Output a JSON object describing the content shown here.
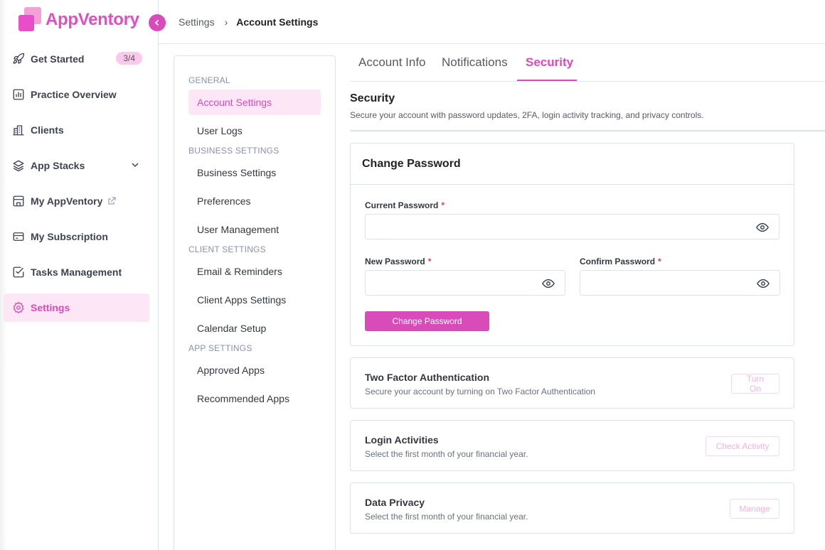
{
  "brand": {
    "name": "AppVentory",
    "accent": "#d94bb9"
  },
  "nav": {
    "items": [
      {
        "key": "get-started",
        "label": "Get Started",
        "icon": "rocket-icon",
        "badge": "3/4"
      },
      {
        "key": "practice-overview",
        "label": "Practice Overview",
        "icon": "bar-chart-icon"
      },
      {
        "key": "clients",
        "label": "Clients",
        "icon": "buildings-icon"
      },
      {
        "key": "app-stacks",
        "label": "App Stacks",
        "icon": "layers-icon"
      },
      {
        "key": "my-appventory",
        "label": "My AppVentory",
        "icon": "storefront-icon"
      },
      {
        "key": "my-subscription",
        "label": "My Subscription",
        "icon": "credit-card-icon"
      },
      {
        "key": "tasks-management",
        "label": "Tasks Management",
        "icon": "checklist-icon"
      },
      {
        "key": "settings",
        "label": "Settings",
        "icon": "gear-icon",
        "active": true
      }
    ]
  },
  "breadcrumb": {
    "root": "Settings",
    "current": "Account Settings"
  },
  "subnav": {
    "general": {
      "heading": "GENERAL",
      "items": [
        "Account Settings",
        "User Logs"
      ]
    },
    "business": {
      "heading": "BUSINESS SETTINGS",
      "items": [
        "Business Settings",
        "Preferences",
        "User Management"
      ]
    },
    "client": {
      "heading": "CLIENT SETTINGS",
      "items": [
        "Email & Reminders",
        "Client Apps Settings",
        "Calendar Setup"
      ]
    },
    "app": {
      "heading": "APP SETTINGS",
      "items": [
        "Approved Apps",
        "Recommended Apps"
      ]
    },
    "active": "Account Settings"
  },
  "tabs": [
    {
      "label": "Account Info"
    },
    {
      "label": "Notifications"
    },
    {
      "label": "Security",
      "active": true
    }
  ],
  "security": {
    "title": "Security",
    "description": "Secure your account with password updates, 2FA, login activity tracking, and privacy controls."
  },
  "change_password": {
    "title": "Change Password",
    "current_label": "Current Password",
    "new_label": "New Password",
    "confirm_label": "Confirm Password",
    "required_mark": "*",
    "current_value": "",
    "new_value": "",
    "confirm_value": "",
    "button": "Change Password"
  },
  "options": [
    {
      "key": "two-factor",
      "title": "Two Factor Authentication",
      "description": "Secure your account by turning on Two Factor Authentication",
      "button": "Turn On"
    },
    {
      "key": "login-activities",
      "title": "Login Activities",
      "description": "Select the first month of your financial year.",
      "button": "Check Activity"
    },
    {
      "key": "data-privacy",
      "title": "Data Privacy",
      "description": "Select the first month of your financial year.",
      "button": "Manage"
    }
  ]
}
